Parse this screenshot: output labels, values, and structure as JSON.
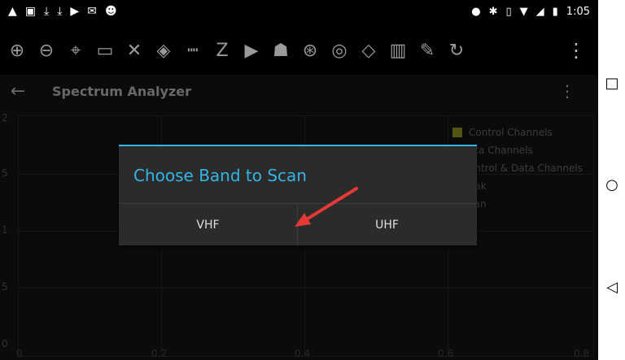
{
  "status": {
    "left_icons": [
      "warning-icon",
      "image-icon",
      "download-icon",
      "download-icon",
      "youtube-icon",
      "gmail-icon",
      "android-icon"
    ],
    "right_icons": [
      "location-icon",
      "bluetooth-icon",
      "vibrate-icon",
      "wifi-icon",
      "signal-icon",
      "battery-icon"
    ],
    "time": "1:05"
  },
  "toolbar": {
    "icons": [
      "zoom-in-icon",
      "zoom-out-icon",
      "gps-icon",
      "rectangle-icon",
      "close-x-icon",
      "compass-icon",
      "ruler-icon",
      "zoom-route-icon",
      "play-icon",
      "group-icon",
      "add-location-icon",
      "radio-icon",
      "layers-icon",
      "map-icon",
      "edit-icon",
      "share-icon"
    ]
  },
  "app": {
    "title": "Spectrum Analyzer"
  },
  "chart_data": {
    "type": "line",
    "x_ticks": [
      "0",
      "0.2",
      "0.4",
      "0.6",
      "0.8"
    ],
    "y_ticks": [
      "2",
      "5",
      "1",
      "5",
      "0"
    ],
    "legend": [
      {
        "label": "Control Channels",
        "color": "#9a9a2a"
      },
      {
        "label": "ata Channels",
        "color": "#4a3aa0"
      },
      {
        "label": "ontrol & Data Channels",
        "color": "#2a2a2a"
      },
      {
        "label": "eak",
        "color": "#2a2a2a"
      },
      {
        "label": "can",
        "color": "#2a2a2a"
      }
    ],
    "series": []
  },
  "dialog": {
    "title": "Choose Band to Scan",
    "options": [
      "VHF",
      "UHF"
    ]
  }
}
